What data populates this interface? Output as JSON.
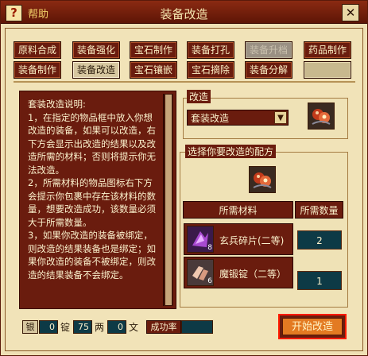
{
  "window": {
    "title": "装备改造",
    "help_label": "帮助",
    "help_icon": "?",
    "close_icon": "✕"
  },
  "tabs": [
    {
      "label": "原料合成",
      "state": "normal"
    },
    {
      "label": "装备强化",
      "state": "normal"
    },
    {
      "label": "宝石制作",
      "state": "normal"
    },
    {
      "label": "装备打孔",
      "state": "normal"
    },
    {
      "label": "装备升档",
      "state": "disabled"
    },
    {
      "label": "药品制作",
      "state": "normal"
    },
    {
      "label": "装备制作",
      "state": "normal"
    },
    {
      "label": "装备改造",
      "state": "active"
    },
    {
      "label": "宝石镶嵌",
      "state": "normal"
    },
    {
      "label": "宝石摘除",
      "state": "normal"
    },
    {
      "label": "装备分解",
      "state": "normal"
    },
    {
      "label": "",
      "state": "empty"
    }
  ],
  "instructions": {
    "text": "套装改造说明:\n1，在指定的物品框中放入你想改造的装备，如果可以改造，右下方会显示出改造的结果以及改造所需的材料；否则将提示你无法改造。\n2，所需材料的物品图标右下方会提示你包裹中存在该材料的数量，想要改造成功，该数量必须大于所需数量。\n3，如果你改造的装备被绑定，则改造的结果装备也是绑定；如果你改造的装备不被绑定，则改造的结果装备不会绑定。"
  },
  "modify": {
    "label": "改造",
    "select_value": "套装改造",
    "select_arrow": "▼"
  },
  "recipe": {
    "label": "选择你要改造的配方",
    "header_material": "所需材料",
    "header_quantity": "所需数量",
    "materials": [
      {
        "name": "玄兵碎片(二等)",
        "quantity": "2",
        "owned": "8"
      },
      {
        "name": "魔锻锭（二等）",
        "quantity": "1",
        "owned": "6"
      }
    ]
  },
  "cost": {
    "silver_label": "银",
    "ding_value": "0",
    "ding_unit": "锭",
    "liang_value": "75",
    "liang_unit": "两",
    "wen_value": "0",
    "wen_unit": "文",
    "success_rate_label": "成功率",
    "success_rate_value": ""
  },
  "start_button": "开始改造",
  "colors": {
    "panel_bg": "#efe0b4",
    "dark_red": "#6a1c0e",
    "teal_field": "#0d3a46",
    "start_orange": "#e37a22",
    "highlight_red": "#ff1a00"
  }
}
